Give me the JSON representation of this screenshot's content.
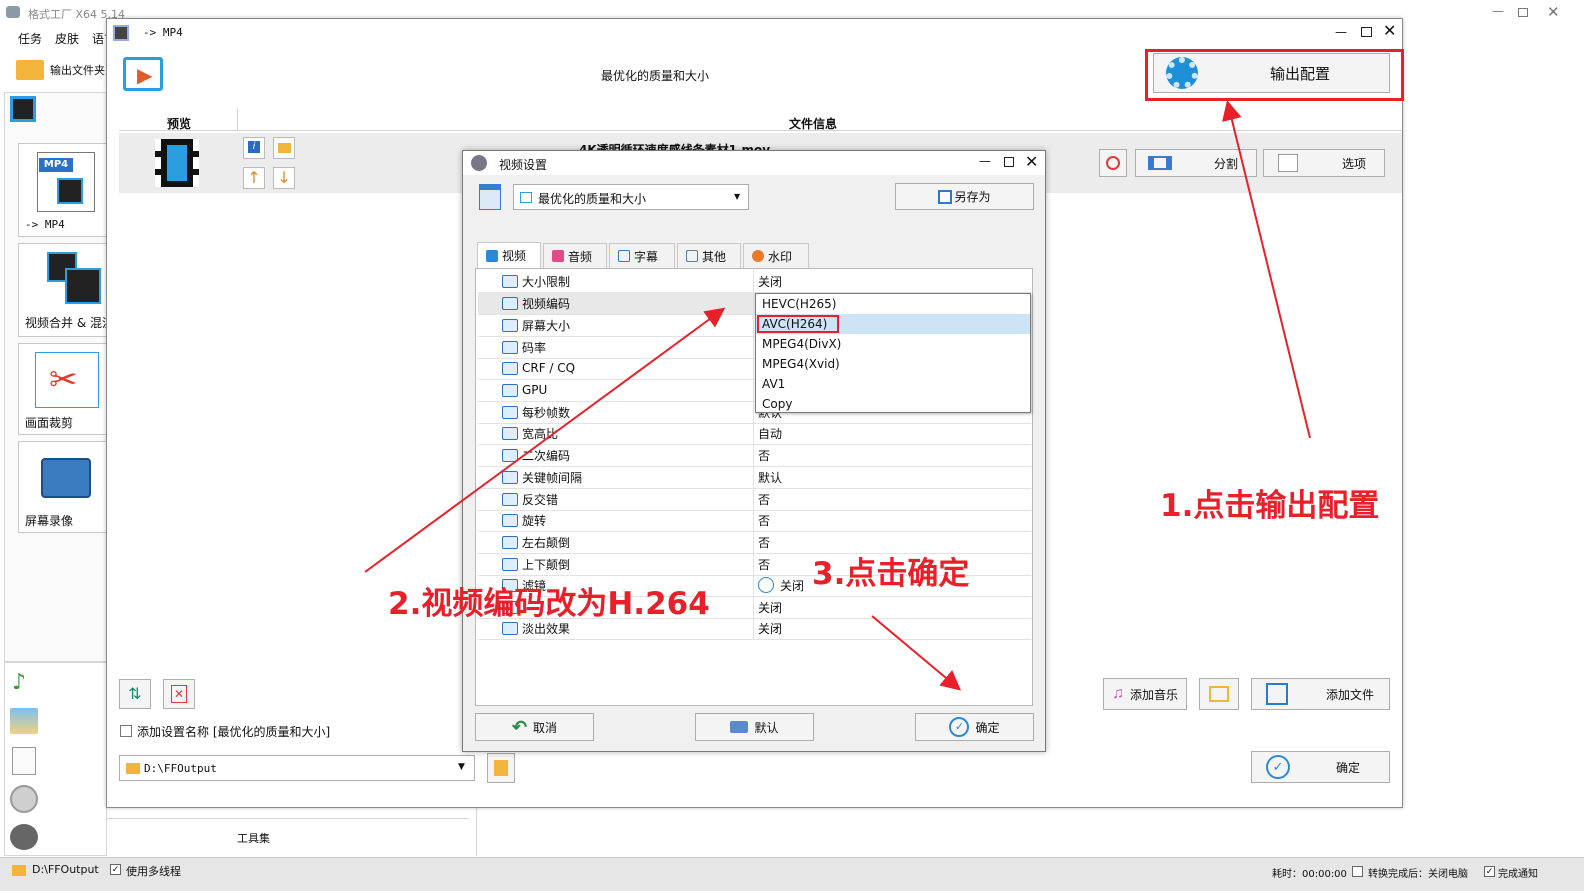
{
  "main_window": {
    "title": "格式工厂 X64 5.14",
    "menu": [
      "任务",
      "皮肤",
      "语言"
    ],
    "output_folder_label": "输出文件夹",
    "sidebar_items": [
      "-> MP4",
      "视频合并 & 混流",
      "画面裁剪",
      "屏幕录像"
    ],
    "toolbox_label": "工具集",
    "status_bar": {
      "path": "D:\\FFOutput",
      "multithread_label": "使用多线程",
      "elapsed_label": "耗时：00:00:00",
      "after_convert_label": "转换完成后：关闭电脑",
      "notify_label": "完成通知"
    }
  },
  "mp4_window": {
    "title": "-> MP4",
    "profile_name": "最优化的质量和大小",
    "output_config_label": "输出配置",
    "col_preview": "预览",
    "col_file_info": "文件信息",
    "file_name": "4K透明循环速度感线条素材1.mov",
    "split_label": "分割",
    "options_label": "选项",
    "add_music_label": "添加音乐",
    "add_file_label": "添加文件",
    "add_setting_name_label": "添加设置名称 [最优化的质量和大小]",
    "output_path": "D:\\FFOutput",
    "ok_label": "确定"
  },
  "video_settings": {
    "title": "视频设置",
    "profile_value": "最优化的质量和大小",
    "save_as_label": "另存为",
    "tabs": [
      "视频",
      "音频",
      "字幕",
      "其他",
      "水印"
    ],
    "rows": [
      {
        "key": "大小限制",
        "value": "关闭"
      },
      {
        "key": "视频编码",
        "value": ""
      },
      {
        "key": "屏幕大小",
        "value": ""
      },
      {
        "key": "码率",
        "value": ""
      },
      {
        "key": "CRF / CQ",
        "value": ""
      },
      {
        "key": "GPU",
        "value": ""
      },
      {
        "key": "每秒帧数",
        "value": "默认"
      },
      {
        "key": "宽高比",
        "value": "自动"
      },
      {
        "key": "二次编码",
        "value": "否"
      },
      {
        "key": "关键帧间隔",
        "value": "默认"
      },
      {
        "key": "反交错",
        "value": "否"
      },
      {
        "key": "旋转",
        "value": "否"
      },
      {
        "key": "左右颠倒",
        "value": "否"
      },
      {
        "key": "上下颠倒",
        "value": "否"
      },
      {
        "key": "滤镜",
        "value": "关闭"
      },
      {
        "key": "",
        "value": "关闭"
      },
      {
        "key": "淡出效果",
        "value": "关闭"
      }
    ],
    "codec_options": [
      "HEVC(H265)",
      "AVC(H264)",
      "MPEG4(DivX)",
      "MPEG4(Xvid)",
      "AV1",
      "Copy"
    ],
    "selected_codec": "AVC(H264)",
    "cancel_label": "取消",
    "default_label": "默认",
    "ok_label": "确定"
  },
  "annotations": {
    "step1": "1.点击输出配置",
    "step2": "2.视频编码改为H.264",
    "step3": "3.点击确定"
  },
  "colors": {
    "annotation_red": "#e8202a",
    "accent_blue": "#1e90d8",
    "selection_blue": "#cde4f7"
  }
}
